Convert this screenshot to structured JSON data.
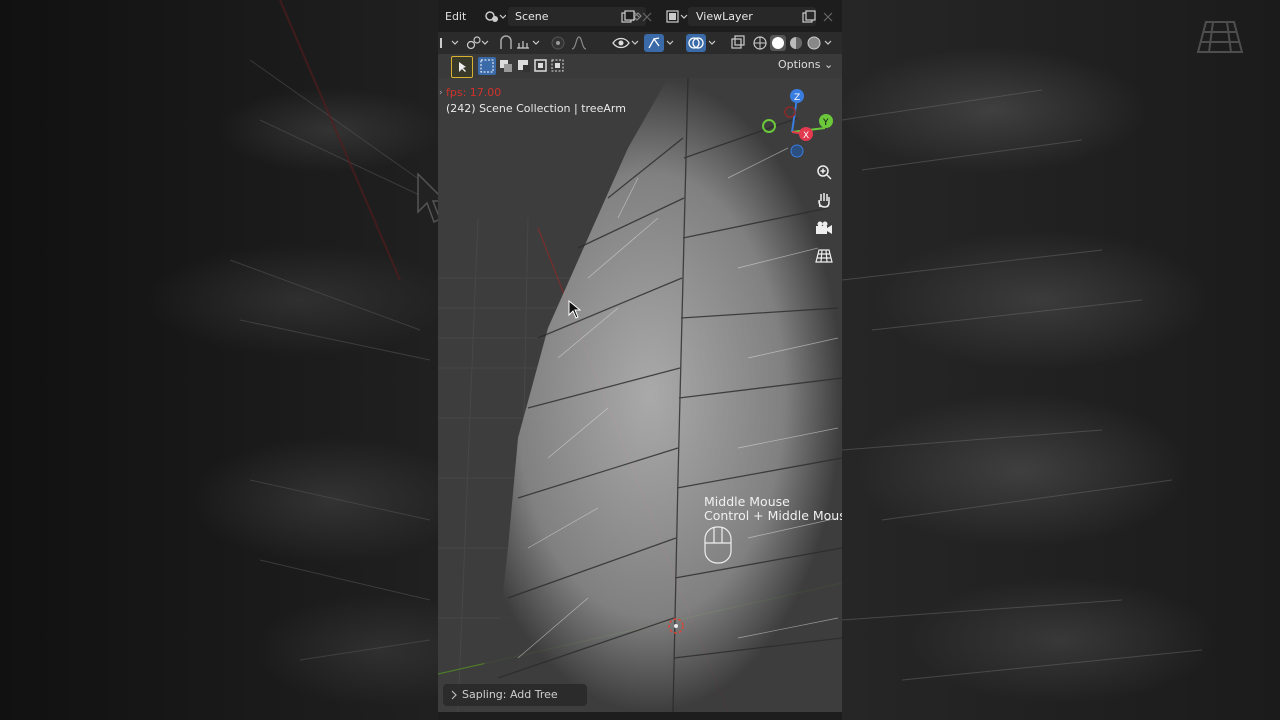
{
  "header": {
    "menu_edit": "Edit",
    "scene_name": "Scene",
    "view_layer_name": "ViewLayer"
  },
  "header_tools": {
    "options_label": "Options"
  },
  "viewport": {
    "fps_text": "fps: 17.00",
    "collection_text": "(242) Scene Collection | treeArm",
    "hint_line1": "Middle Mouse",
    "hint_line2": "Control + Middle Mouse",
    "operator_panel_label": "Sapling: Add Tree"
  },
  "gizmo": {
    "axes": [
      "Z",
      "Y",
      "X"
    ],
    "colors": {
      "x": "#e23a4f",
      "y": "#6ac83a",
      "z": "#3a7de0"
    }
  },
  "icons": [
    "mode-icon",
    "scene-icon",
    "pin-icon",
    "copy-icon",
    "close-icon",
    "viewlayer-icon",
    "select-tool-icon",
    "zoom-icon",
    "pan-hand-icon",
    "camera-icon",
    "ortho-grid-icon",
    "cursor-icon"
  ]
}
